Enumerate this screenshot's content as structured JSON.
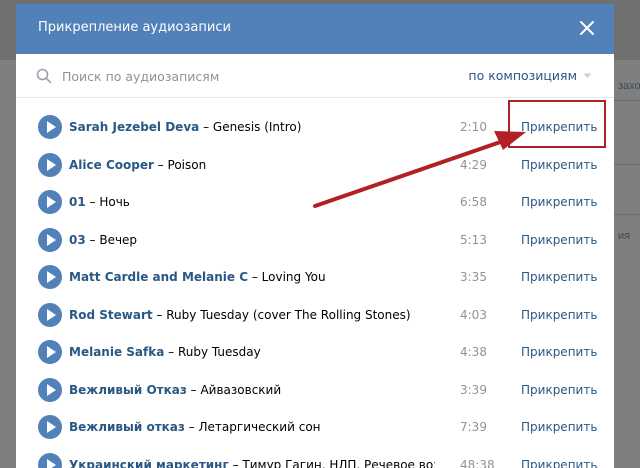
{
  "background": {
    "right_texts": [
      "захо",
      "ия"
    ]
  },
  "modal": {
    "title": "Прикрепление аудиозаписи",
    "close_icon": "close-icon",
    "header_color": "#5181b8"
  },
  "search": {
    "placeholder": "Поиск по аудиозаписям",
    "value": "",
    "sort_label": "по композициям"
  },
  "tracks": [
    {
      "artist": "Sarah Jezebel Deva",
      "title": "Genesis (Intro)",
      "duration": "2:10",
      "action": "Прикрепить"
    },
    {
      "artist": "Alice Cooper",
      "title": "Poison",
      "duration": "4:29",
      "action": "Прикрепить"
    },
    {
      "artist": "01",
      "title": "Ночь",
      "duration": "6:58",
      "action": "Прикрепить"
    },
    {
      "artist": "03",
      "title": "Вечер",
      "duration": "5:13",
      "action": "Прикрепить"
    },
    {
      "artist": "Matt Cardle and Melanie C",
      "title": " Loving You",
      "duration": "3:35",
      "action": "Прикрепить"
    },
    {
      "artist": "Rod Stewart",
      "title": "Ruby Tuesday (cover The Rolling Stones)",
      "duration": "4:03",
      "action": "Прикрепить"
    },
    {
      "artist": "Melanie Safka",
      "title": "Ruby Tuesday",
      "duration": "4:38",
      "action": "Прикрепить"
    },
    {
      "artist": "Вежливый Отказ",
      "title": "Айвазовский",
      "duration": "3:39",
      "action": "Прикрепить"
    },
    {
      "artist": "Вежливый отказ",
      "title": "Летаргический сон",
      "duration": "7:39",
      "action": "Прикрепить"
    },
    {
      "artist": "Украинский маркетинг",
      "title": "Тимур Гагин, НЛП, Речевое воздейст",
      "duration": "48:38",
      "action": "Прикрепить"
    }
  ],
  "annotation": {
    "color": "#b22025"
  }
}
